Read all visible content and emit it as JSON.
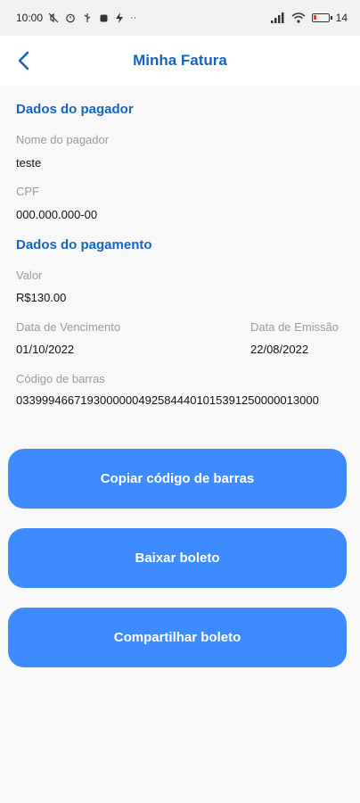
{
  "status_bar": {
    "time": "10:00",
    "battery": "14"
  },
  "header": {
    "title": "Minha Fatura"
  },
  "payer": {
    "section_title": "Dados do pagador",
    "name_label": "Nome do pagador",
    "name_value": "teste",
    "cpf_label": "CPF",
    "cpf_value": "000.000.000-00"
  },
  "payment": {
    "section_title": "Dados do pagamento",
    "amount_label": "Valor",
    "amount_value": "R$130.00",
    "due_date_label": "Data de Vencimento",
    "due_date_value": "01/10/2022",
    "issue_date_label": "Data de Emissão",
    "issue_date_value": "22/08/2022",
    "barcode_label": "Código de barras",
    "barcode_value": "03399946671930000004925844401015391250000013000"
  },
  "actions": {
    "copy_label": "Copiar código de barras",
    "download_label": "Baixar boleto",
    "share_label": "Compartilhar boleto"
  },
  "colors": {
    "accent": "#1565c0",
    "button": "#3d8bff"
  }
}
